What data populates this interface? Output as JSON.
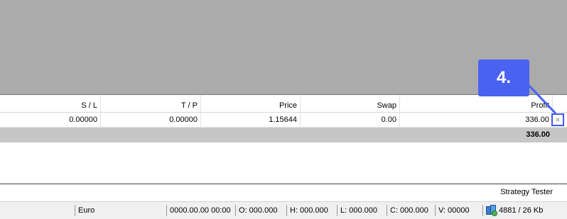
{
  "table": {
    "columns": [
      "S / L",
      "T / P",
      "Price",
      "Swap",
      "Profit"
    ],
    "rows": [
      {
        "sl": "0.00000",
        "tp": "0.00000",
        "price": "1.15644",
        "swap": "0.00",
        "profit": "336.00"
      }
    ],
    "total_profit": "336.00",
    "close_glyph": "×"
  },
  "callout": {
    "label": "4."
  },
  "panel": {
    "tab_label": "Strategy Tester"
  },
  "status_bar": {
    "profile": "Euro",
    "datetime": "0000.00.00 00:00",
    "open": "O: 000.000",
    "high": "H: 000.000",
    "low": "L: 000.000",
    "close": "C: 000.000",
    "volume": "V: 00000",
    "connection_icon": "connection-status-icon",
    "traffic": "4881 / 26 Kb"
  },
  "colors": {
    "accent": "#4a62f2",
    "chart_bg": "#ababab",
    "total_row_bg": "#c6c6c6"
  }
}
